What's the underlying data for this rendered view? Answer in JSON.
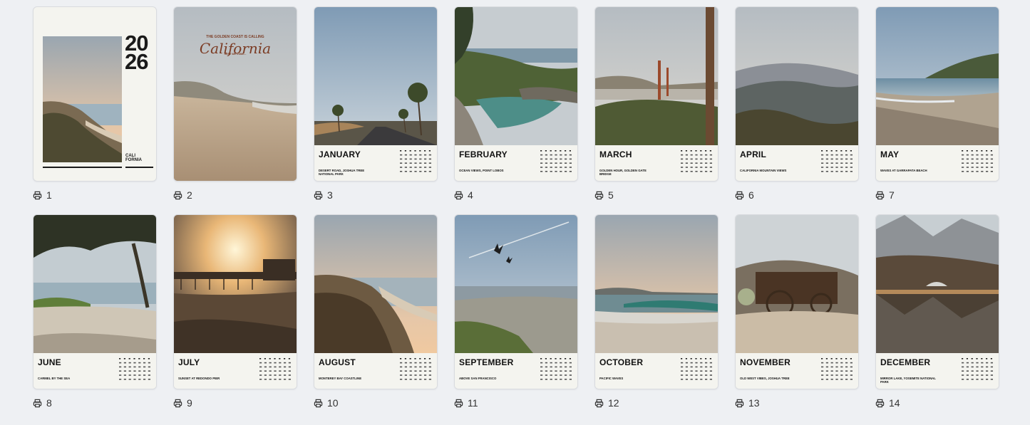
{
  "cover": {
    "year_line1": "20",
    "year_line2": "26",
    "sub_line1": "CALI",
    "sub_line2": "FORNIA"
  },
  "title_page": {
    "small_text": "THE GOLDEN COAST IS CALLING",
    "script_text": "California",
    "tiny_text": "HERE WE COME..."
  },
  "pages": [
    {
      "num": "1"
    },
    {
      "num": "2"
    },
    {
      "num": "3",
      "month": "JANUARY",
      "caption": "DESERT ROAD, JOSHUA TREE NATIONAL PARK"
    },
    {
      "num": "4",
      "month": "FEBRUARY",
      "caption": "OCEAN VIEWS, POINT LOBOS"
    },
    {
      "num": "5",
      "month": "MARCH",
      "caption": "GOLDEN HOUR, GOLDEN GATE BRIDGE"
    },
    {
      "num": "6",
      "month": "APRIL",
      "caption": "CALIFORNIA MOUNTAIN VIEWS"
    },
    {
      "num": "7",
      "month": "MAY",
      "caption": "WAVES AT GARRAPATA BEACH"
    },
    {
      "num": "8",
      "month": "JUNE",
      "caption": "CARMEL BY THE SEA"
    },
    {
      "num": "9",
      "month": "JULY",
      "caption": "SUNSET AT REDONDO PIER"
    },
    {
      "num": "10",
      "month": "AUGUST",
      "caption": "MONTEREY BAY COASTLINE"
    },
    {
      "num": "11",
      "month": "SEPTEMBER",
      "caption": "ABOVE SAN FRANCISCO"
    },
    {
      "num": "12",
      "month": "OCTOBER",
      "caption": "PACIFIC WAVES"
    },
    {
      "num": "13",
      "month": "NOVEMBER",
      "caption": "OLD WEST VIBES, JOSHUA TREE"
    },
    {
      "num": "14",
      "month": "DECEMBER",
      "caption": "MIRROR LAKE, YOSEMITE NATIONAL PARK"
    }
  ],
  "icons": {
    "page_label_icon": "printer-icon"
  },
  "colors": {
    "background": "#eef0f3",
    "page": "#f4f4ef",
    "text": "#111111",
    "script": "#7b3b23"
  }
}
